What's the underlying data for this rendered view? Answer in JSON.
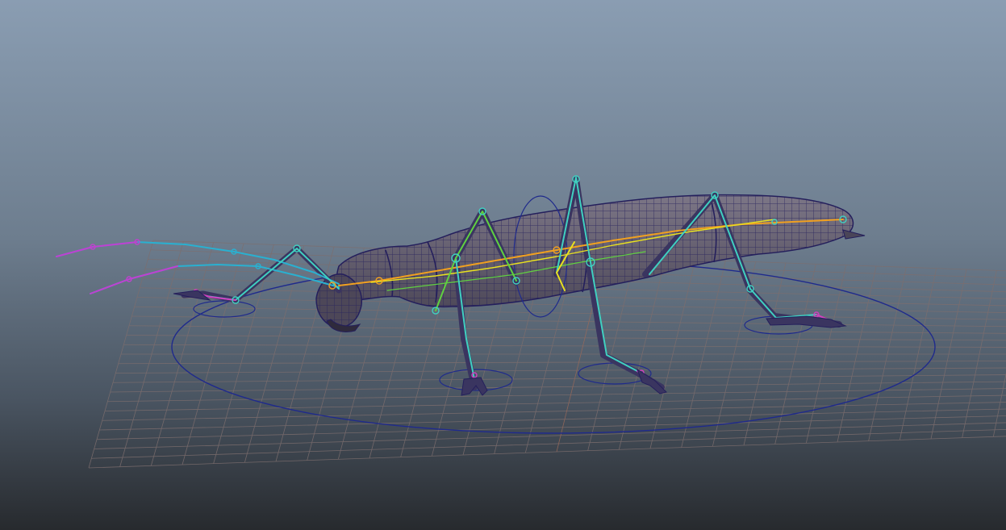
{
  "viewport": {
    "background_top": "#8a9db2",
    "background_bottom": "#272a2e",
    "grid_color": "#7d6e6e",
    "grid_axis_color": "#9a6a5a",
    "ground_control_color": "#1f2a8c",
    "mesh_color": "#241f5c",
    "body_fill": "#6e6878",
    "skeleton_colors": {
      "antenna_tip": "#c040d0",
      "antenna_mid": "#2ab0d0",
      "spine": "#f0a020",
      "spine_secondary": "#e8e020",
      "legs": "#40d0c0",
      "legs_alt": "#60d040",
      "feet": "#d040c0"
    }
  }
}
